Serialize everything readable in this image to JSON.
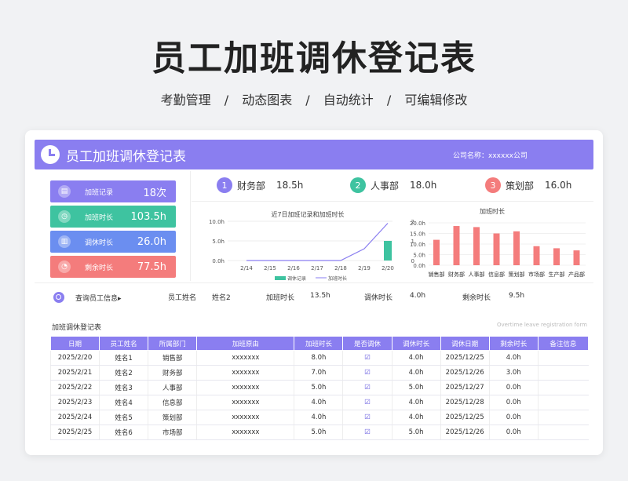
{
  "hero": {
    "title": "员工加班调休登记表",
    "sub1": "考勤管理",
    "sub2": "动态图表",
    "sub3": "自动统计",
    "sub4": "可编辑修改",
    "sep": "/"
  },
  "header": {
    "title": "员工加班调休登记表",
    "company_label": "公司名称：",
    "company_value": "xxxxxx公司"
  },
  "kpis": [
    {
      "label": "加班记录",
      "value": "18次",
      "color": "#8a7ef0",
      "icon": "chart-icon"
    },
    {
      "label": "加班时长",
      "value": "103.5h",
      "color": "#3ec3a0",
      "icon": "clock-icon"
    },
    {
      "label": "调休时长",
      "value": "26.0h",
      "color": "#6b8ef0",
      "icon": "bar-icon"
    },
    {
      "label": "剩余时长",
      "value": "77.5h",
      "color": "#f47c7c",
      "icon": "timer-icon"
    }
  ],
  "depts": [
    {
      "num": "1",
      "name": "财务部",
      "value": "18.5h",
      "color": "#8a7ef0"
    },
    {
      "num": "2",
      "name": "人事部",
      "value": "18.0h",
      "color": "#3ec3a0"
    },
    {
      "num": "3",
      "name": "策划部",
      "value": "16.0h",
      "color": "#f47c7c"
    }
  ],
  "chart1_title": "近7日加班记录和加班时长",
  "chart2_title": "加班时长",
  "chart_data": [
    {
      "type": "bar",
      "title": "近7日加班记录和加班时长",
      "categories": [
        "2/14",
        "2/15",
        "2/16",
        "2/17",
        "2/18",
        "2/19",
        "2/20"
      ],
      "y_left_ticks": [
        "10.0h",
        "5.0h",
        "0.0h"
      ],
      "y_right_ticks": [
        "2",
        "1",
        "0"
      ],
      "series": [
        {
          "name": "调休记录",
          "type": "bar",
          "values": [
            0,
            0,
            0,
            0,
            0,
            0,
            5
          ]
        },
        {
          "name": "加班时长",
          "type": "line",
          "values": [
            0,
            0,
            0,
            0,
            0,
            0.6,
            1.9
          ]
        }
      ],
      "ylim": [
        0,
        10
      ],
      "y2lim": [
        0,
        2
      ]
    },
    {
      "type": "bar",
      "title": "加班时长",
      "categories": [
        "销售部",
        "财务部",
        "人事部",
        "信息部",
        "策划部",
        "市场部",
        "生产部",
        "产品部"
      ],
      "values": [
        12,
        18.5,
        18,
        15,
        16,
        9,
        8,
        7
      ],
      "y_ticks": [
        "20.0h",
        "15.0h",
        "10.0h",
        "5.0h",
        "0.0h"
      ],
      "ylim": [
        0,
        20
      ]
    }
  ],
  "query": {
    "label": "查询员工信息▸",
    "name_label": "员工姓名",
    "name_value": "姓名2",
    "ot_label": "加班时长",
    "ot_value": "13.5h",
    "rest_label": "调休时长",
    "rest_value": "4.0h",
    "remain_label": "剩余时长",
    "remain_value": "9.5h"
  },
  "table": {
    "title": "加班调休登记表",
    "subtitle": "Overtime leave registration form",
    "headers": [
      "日期",
      "员工姓名",
      "所属部门",
      "加班原由",
      "加班时长",
      "是否调休",
      "调休时长",
      "调休日期",
      "剩余时长",
      "备注信息"
    ],
    "rows": [
      [
        "2025/2/20",
        "姓名1",
        "销售部",
        "xxxxxxx",
        "8.0h",
        "☑",
        "4.0h",
        "2025/12/25",
        "4.0h",
        ""
      ],
      [
        "2025/2/21",
        "姓名2",
        "财务部",
        "xxxxxxx",
        "7.0h",
        "☑",
        "4.0h",
        "2025/12/26",
        "3.0h",
        ""
      ],
      [
        "2025/2/22",
        "姓名3",
        "人事部",
        "xxxxxxx",
        "5.0h",
        "☑",
        "5.0h",
        "2025/12/27",
        "0.0h",
        ""
      ],
      [
        "2025/2/23",
        "姓名4",
        "信息部",
        "xxxxxxx",
        "4.0h",
        "☑",
        "4.0h",
        "2025/12/28",
        "0.0h",
        ""
      ],
      [
        "2025/2/24",
        "姓名5",
        "策划部",
        "xxxxxxx",
        "4.0h",
        "☑",
        "4.0h",
        "2025/12/25",
        "0.0h",
        ""
      ],
      [
        "2025/2/25",
        "姓名6",
        "市场部",
        "xxxxxxx",
        "5.0h",
        "☑",
        "5.0h",
        "2025/12/26",
        "0.0h",
        ""
      ]
    ]
  }
}
